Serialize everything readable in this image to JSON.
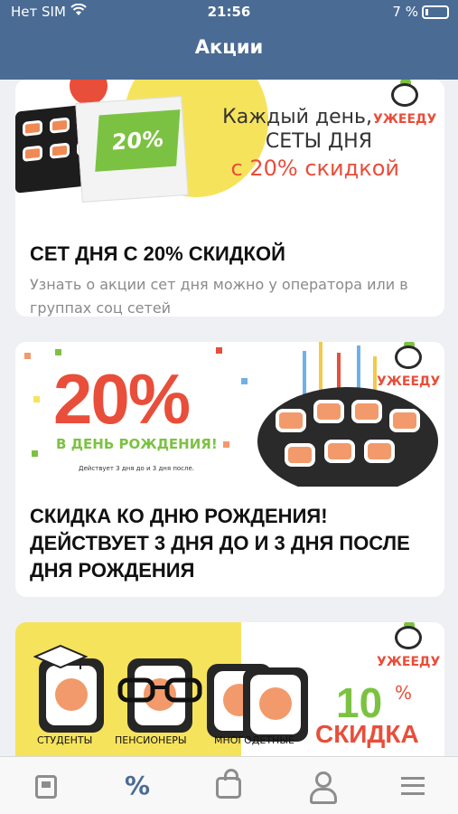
{
  "status_bar": {
    "carrier": "Нет SIM",
    "time": "21:56",
    "battery": "7 %"
  },
  "header": {
    "title": "Акции"
  },
  "promos": [
    {
      "banner": {
        "line1": "Каждый день,",
        "line2": "СЕТЫ ДНЯ",
        "line3": "с 20% скидкой",
        "calendar_text": "20%",
        "logo_text": "УЖЕЕДУ"
      },
      "title": "СЕТ ДНЯ С 20% СКИДКОЙ",
      "description": "Узнать о акции сет дня можно у оператора или в группах соц сетей"
    },
    {
      "banner": {
        "big_percent": "20%",
        "subtitle": "В ДЕНЬ РОЖДЕНИЯ!",
        "fine_print": "Действует 3 дня до и 3 дня после.",
        "logo_text": "УЖЕЕДУ"
      },
      "title": "СКИДКА КО ДНЮ РОЖДЕНИЯ! ДЕЙСТВУЕТ 3 ДНЯ ДО И 3 ДНЯ ПОСЛЕ ДНЯ РОЖДЕНИЯ"
    },
    {
      "banner": {
        "label_students": "СТУДЕНТЫ",
        "label_pensioners": "ПЕНСИОНЕРЫ",
        "label_large_families": "МНОГОДЕТНЫЕ",
        "discount_number": "10",
        "discount_percent": "%",
        "discount_word": "СКИДКА",
        "logo_text": "УЖЕЕДУ"
      }
    }
  ],
  "tab_bar": {
    "active_tab": "promotions",
    "promotions_glyph": "%",
    "icons": [
      "news-icon",
      "percent-icon",
      "shopping-bag-icon",
      "profile-icon",
      "menu-icon"
    ]
  },
  "colors": {
    "header_bg": "#4a6b94",
    "accent_red": "#e84e3a",
    "accent_green": "#7cc242",
    "accent_yellow": "#f6e35c"
  }
}
